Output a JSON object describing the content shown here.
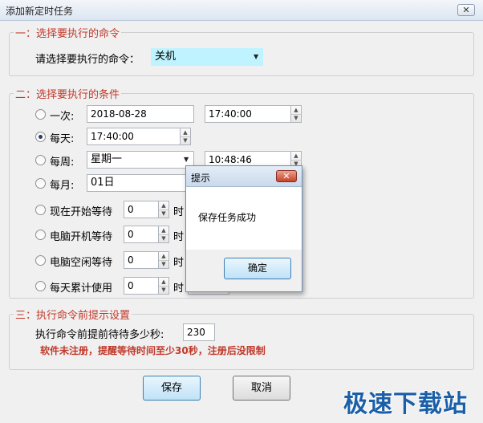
{
  "window": {
    "title": "添加新定时任务",
    "close": "✕"
  },
  "section1": {
    "title": "一：选择要执行的命令",
    "prompt": "请选择要执行的命令：",
    "command": "关机"
  },
  "section2": {
    "title": "二：选择要执行的条件",
    "once": {
      "label": "一次:",
      "date": "2018-08-28",
      "time": "17:40:00"
    },
    "daily": {
      "label": "每天:",
      "time": "17:40:00"
    },
    "weekly": {
      "label": "每周:",
      "day": "星期一",
      "time": "10:48:46"
    },
    "monthly": {
      "label": "每月:",
      "day": "01日"
    },
    "wait_now": {
      "label": "现在开始等待",
      "value": "0",
      "unit": "时"
    },
    "wait_boot": {
      "label": "电脑开机等待",
      "value": "0",
      "unit": "时"
    },
    "wait_idle": {
      "label": "电脑空闲等待",
      "value": "0",
      "unit": "时"
    },
    "daily_use": {
      "label": "每天累计使用",
      "value": "0",
      "unit": "时"
    }
  },
  "section3": {
    "title": "三：执行命令前提示设置",
    "prompt": "执行命令前提前待待多少秒:",
    "seconds": "230",
    "warning": "软件未注册，提醒等待时间至少30秒，注册后没限制"
  },
  "buttons": {
    "save": "保存",
    "cancel": "取消"
  },
  "popup": {
    "title": "提示",
    "message": "保存任务成功",
    "ok": "确定",
    "close": "✕"
  },
  "watermark": "极速下载站",
  "colors": {
    "section_title": "#c0392b",
    "warning": "#c0392b",
    "highlight": "#bff3ff"
  }
}
